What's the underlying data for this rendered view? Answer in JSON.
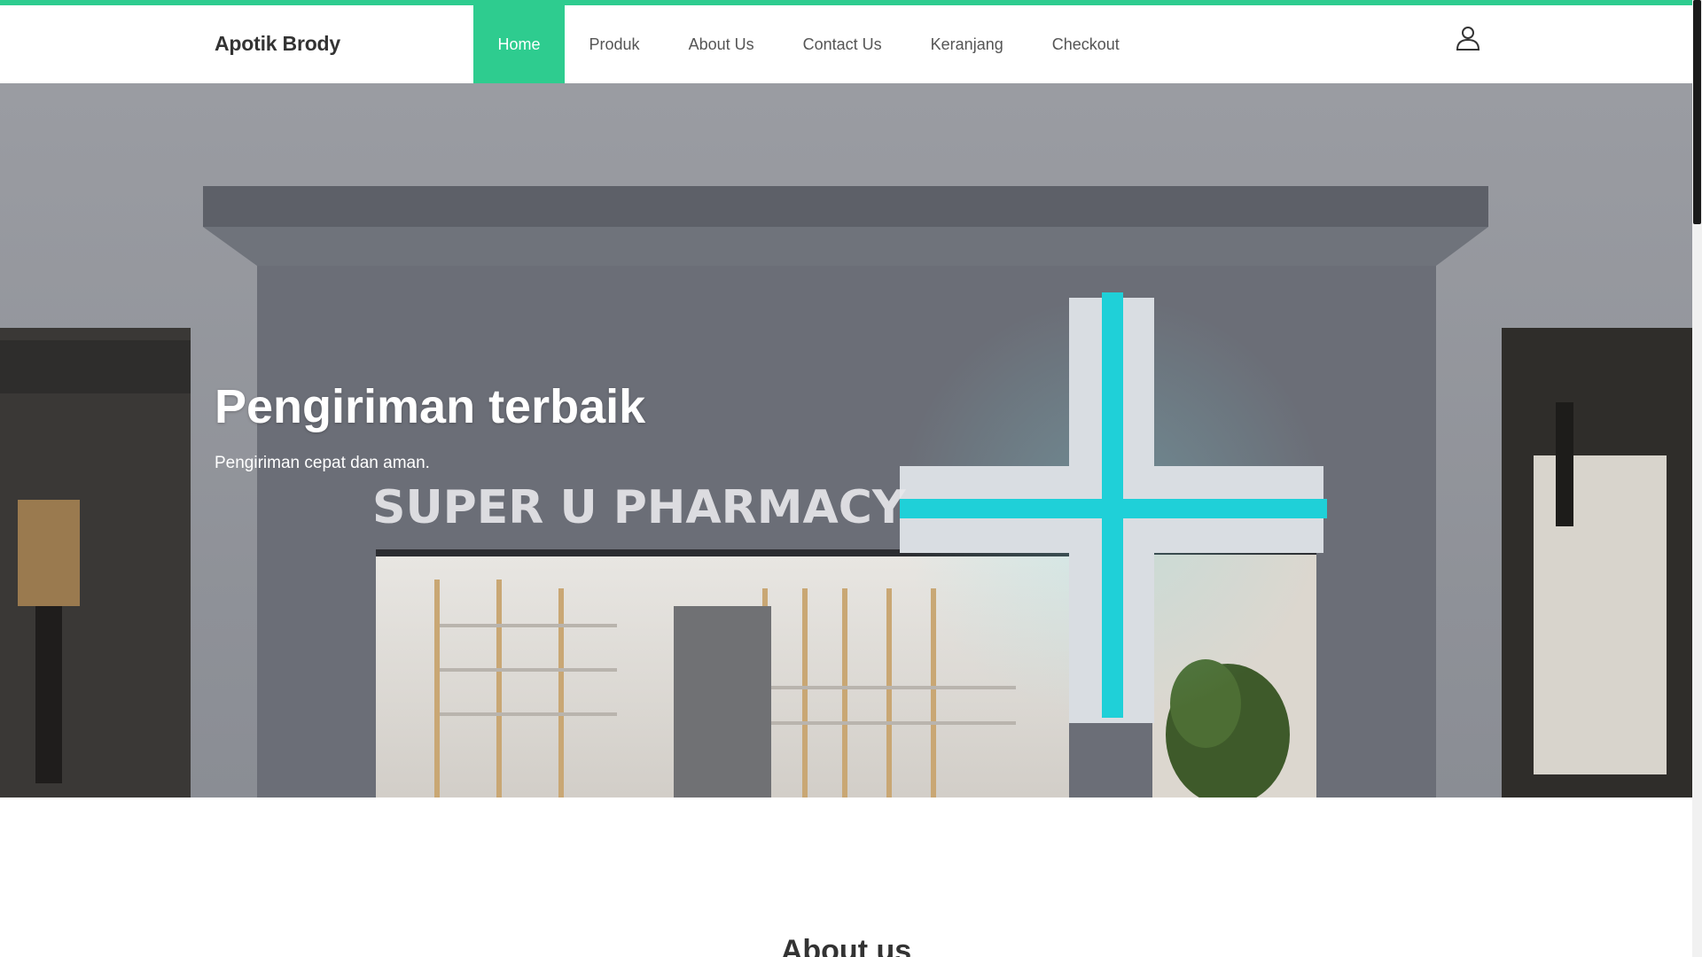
{
  "brand": {
    "name": "Apotik Brody"
  },
  "nav": {
    "items": [
      {
        "label": "Home",
        "active": true
      },
      {
        "label": "Produk",
        "active": false
      },
      {
        "label": "About Us",
        "active": false
      },
      {
        "label": "Contact Us",
        "active": false
      },
      {
        "label": "Keranjang",
        "active": false
      },
      {
        "label": "Checkout",
        "active": false
      }
    ],
    "user_icon": "user-icon"
  },
  "hero": {
    "title": "Pengiriman terbaik",
    "subtitle": "Pengiriman cepat dan aman.",
    "sign_text": "SUPER U PHARMACY"
  },
  "about": {
    "title": "About us"
  },
  "colors": {
    "accent": "#2ecc8f",
    "cross": "#1fd0d8"
  }
}
